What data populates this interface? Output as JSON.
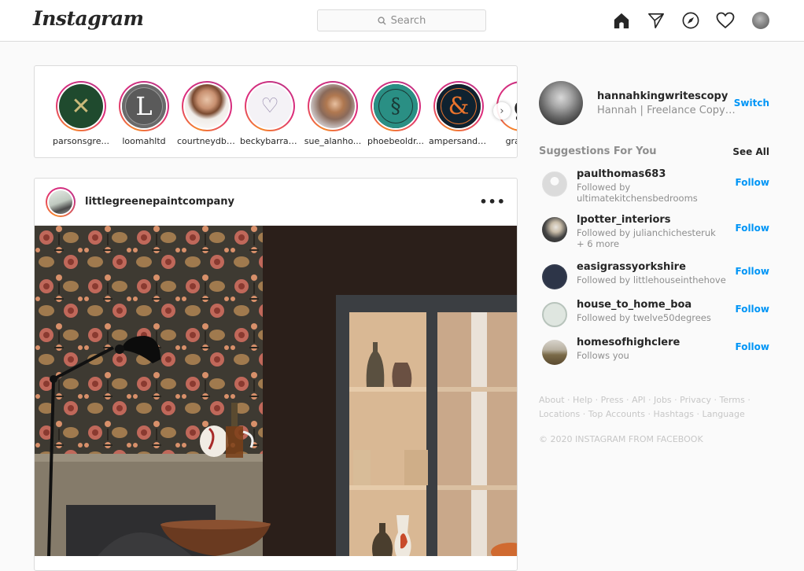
{
  "header": {
    "logo": "Instagram",
    "search_placeholder": "Search",
    "nav": [
      "home-icon",
      "direct-messages-icon",
      "explore-icon",
      "activity-heart-icon",
      "profile-avatar"
    ]
  },
  "stories": [
    {
      "name": "parsonsgre...",
      "bg": "#1f4a2e",
      "glyph": "✕",
      "fg": "#c9b97a"
    },
    {
      "name": "loomahltd",
      "bg": "#5a5a5a",
      "glyph": "L",
      "fg": "#ffffff"
    },
    {
      "name": "courtneydbl...",
      "bg": "#e9e4df",
      "glyph": "",
      "fg": "#a07050"
    },
    {
      "name": "beckybarrac...",
      "bg": "#f4f2f6",
      "glyph": "♡",
      "fg": "#9b8fb0"
    },
    {
      "name": "sue_alanho...",
      "bg": "#a88a78",
      "glyph": "",
      "fg": "#ffffff"
    },
    {
      "name": "phoebeoldr...",
      "bg": "#2a8f84",
      "glyph": "§",
      "fg": "#1a3a36"
    },
    {
      "name": "ampersand_...",
      "bg": "#0f2230",
      "glyph": "&",
      "fg": "#e8732c"
    },
    {
      "name": "graceja",
      "bg": "#ffffff",
      "glyph": "g",
      "fg": "#222222"
    }
  ],
  "post": {
    "username": "littlegreenepaintcompany",
    "more": "•••"
  },
  "sidebar": {
    "me": {
      "username": "hannahkingwritescopy",
      "fullname": "Hannah | Freelance Copywriter",
      "switch": "Switch"
    },
    "suggestions_title": "Suggestions For You",
    "see_all": "See All",
    "suggestions": [
      {
        "username": "paulthomas683",
        "sub": "Followed by ultimatekitchensbedrooms",
        "follow": "Follow",
        "avatar": "#dbdbdb"
      },
      {
        "username": "lpotter_interiors",
        "sub": "Followed by julianchichesteruk + 6 more",
        "follow": "Follow",
        "avatar": "#6d6d6d"
      },
      {
        "username": "easigrassyorkshire",
        "sub": "Followed by littlehouseinthehove",
        "follow": "Follow",
        "avatar": "#2d3548"
      },
      {
        "username": "house_to_home_boa",
        "sub": "Followed by twelve50degrees",
        "follow": "Follow",
        "avatar": "#dfe6e0"
      },
      {
        "username": "homesofhighclere",
        "sub": "Follows you",
        "follow": "Follow",
        "avatar": "#8a7a5a"
      }
    ],
    "footer_links": [
      "About",
      "Help",
      "Press",
      "API",
      "Jobs",
      "Privacy",
      "Terms",
      "Locations",
      "Top Accounts",
      "Hashtags",
      "Language"
    ],
    "copyright": "© 2020 INSTAGRAM FROM FACEBOOK"
  },
  "colors": {
    "accent": "#0095f6",
    "border": "#dbdbdb",
    "muted": "#8e8e8e"
  }
}
